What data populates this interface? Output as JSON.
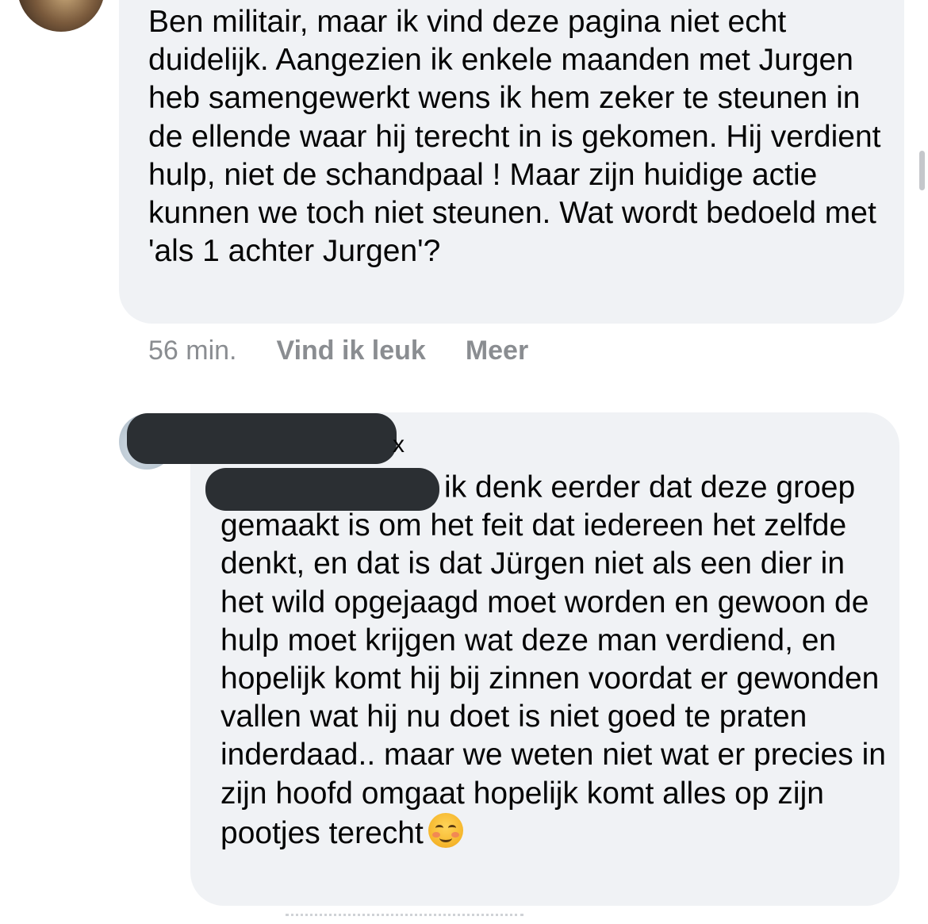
{
  "comments": [
    {
      "text": "Ben militair, maar ik vind deze pagina niet echt duidelijk. Aangezien ik enkele maanden met Jurgen heb samengewerkt wens ik hem zeker te steunen in de ellende waar hij terecht in is gekomen. Hij verdient hulp, niet de schandpaal ! Maar zijn huidige actie kunnen we toch niet steunen. Wat wordt bedoeld met 'als 1 achter Jurgen'?",
      "time": "56 min.",
      "like_label": "Vind ik leuk",
      "more_label": "Meer"
    },
    {
      "author_suffix": "x",
      "text": "ik denk eerder dat deze groep gemaakt is om het feit dat iedereen het zelfde denkt, en dat is dat Jürgen niet als een dier in het wild opgejaagd moet worden en gewoon de hulp moet krijgen wat deze man verdiend, en hopelijk komt hij bij zinnen voordat er gewonden vallen wat hij nu doet is niet goed te praten inderdaad.. maar we weten niet wat er precies in zijn hoofd omgaat hopelijk komt alles op zijn pootjes terecht",
      "emoji_icon": "smiling-face-with-smiling-eyes-icon"
    }
  ],
  "colors": {
    "bubble_bg": "#f0f2f5",
    "meta_text": "#8a8d91",
    "redaction": "#2b2f33"
  }
}
